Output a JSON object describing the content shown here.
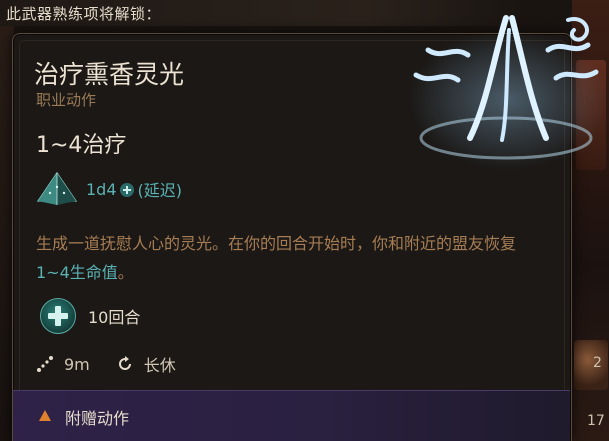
{
  "header": {
    "text": "此武器熟练项将解锁："
  },
  "tooltip": {
    "title": "治疗熏香灵光",
    "subtitle": "职业动作",
    "heal_range": "1~4治疗",
    "dice": {
      "value": "1d4",
      "delay": "(延迟)",
      "icon": "d4-dice-icon"
    },
    "description": {
      "part1": "生成一道抚慰人心的灵光。在你的回合开始时，你和附近的盟友恢复",
      "highlight": "1~4生命值",
      "part2": "。"
    },
    "duration": {
      "text": "10回合",
      "icon": "heal-plus-icon"
    },
    "range": {
      "text": "9m",
      "icon": "range-icon"
    },
    "recharge": {
      "text": "长休",
      "icon": "long-rest-icon"
    },
    "footer": {
      "text": "附赠动作",
      "icon": "bonus-action-triangle-icon"
    },
    "spell_icon": "incense-aura-icon"
  },
  "background": {
    "num1": "2",
    "num2": "17"
  },
  "colors": {
    "accent_teal": "#5ab2b2",
    "subtitle_brown": "#9a7b56",
    "desc_brown": "#a77d53",
    "footer_purple": "#2e2248",
    "bonus_orange": "#e0812e"
  }
}
